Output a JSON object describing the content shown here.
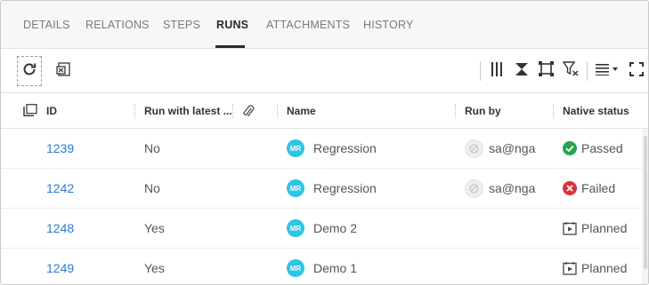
{
  "tabs": {
    "details": "DETAILS",
    "relations": "RELATIONS",
    "steps": "STEPS",
    "runs": "RUNS",
    "attachments": "ATTACHMENTS",
    "history": "HISTORY",
    "active": "RUNS"
  },
  "toolbar": {
    "left_icons": [
      "refresh-icon",
      "export-excel-icon"
    ],
    "right_icons": [
      "columns-icon",
      "collapse-icon",
      "fit-icon",
      "filter-icon",
      "density-icon",
      "fullscreen-icon"
    ]
  },
  "table": {
    "columns": {
      "id": "ID",
      "run_with_latest": "Run with latest ...",
      "attachment": "",
      "name": "Name",
      "run_by": "Run by",
      "native_status": "Native status"
    },
    "rows": [
      {
        "id": "1239",
        "run_with_latest": "No",
        "badge": "MR",
        "name": "Regression",
        "run_by": "sa@nga",
        "status": "Passed",
        "status_icon": "check-circle-icon"
      },
      {
        "id": "1242",
        "run_with_latest": "No",
        "badge": "MR",
        "name": "Regression",
        "run_by": "sa@nga",
        "status": "Failed",
        "status_icon": "x-circle-icon"
      },
      {
        "id": "1248",
        "run_with_latest": "Yes",
        "badge": "MR",
        "name": "Demo 2",
        "run_by": "",
        "status": "Planned",
        "status_icon": "planned-icon"
      },
      {
        "id": "1249",
        "run_with_latest": "Yes",
        "badge": "MR",
        "name": "Demo 1",
        "run_by": "",
        "status": "Planned",
        "status_icon": "planned-icon"
      }
    ]
  },
  "colors": {
    "link": "#2b7bd3",
    "badge": "#2ec4e8",
    "passed": "#2aa44f",
    "failed": "#d9343a"
  }
}
